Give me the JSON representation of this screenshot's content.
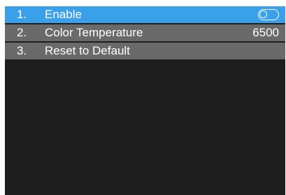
{
  "menu": {
    "items": [
      {
        "number": "1.",
        "label": "Enable",
        "type": "toggle",
        "toggle_state": "off"
      },
      {
        "number": "2.",
        "label": "Color Temperature",
        "type": "value",
        "value": "6500"
      },
      {
        "number": "3.",
        "label": "Reset to Default",
        "type": "action"
      }
    ]
  },
  "colors": {
    "selected_row": "#3aa0ea",
    "row": "#6a6a6a",
    "background": "#1e1e1e",
    "text": "#ffffff"
  }
}
